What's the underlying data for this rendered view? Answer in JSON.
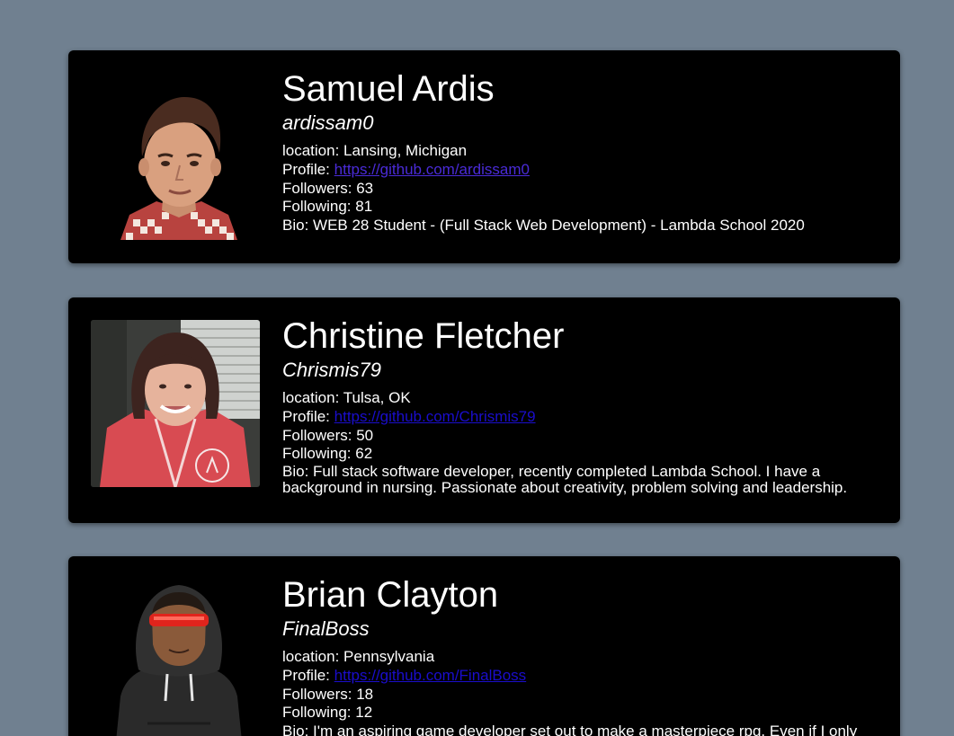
{
  "cards": [
    {
      "name": "Samuel Ardis",
      "login": "ardissam0",
      "location_label": "location: ",
      "location": "Lansing, Michigan",
      "profile_label": "Profile: ",
      "profile_url": "https://github.com/ardissam0",
      "followers_label": "Followers: ",
      "followers": "63",
      "following_label": "Following: ",
      "following": "81",
      "bio_label": "Bio: ",
      "bio": "WEB 28 Student - (Full Stack Web Development) - Lambda School 2020",
      "link_color": "#4a2bd8"
    },
    {
      "name": "Christine Fletcher",
      "login": "Chrismis79",
      "location_label": "location: ",
      "location": "Tulsa, OK",
      "profile_label": "Profile: ",
      "profile_url": "https://github.com/Chrismis79",
      "followers_label": "Followers: ",
      "followers": "50",
      "following_label": "Following: ",
      "following": "62",
      "bio_label": "Bio: ",
      "bio": "Full stack software developer, recently completed Lambda School. I have a background in nursing. Passionate about creativity, problem solving and leadership.",
      "link_color": "#1a0dcc"
    },
    {
      "name": "Brian Clayton",
      "login": "FinalBoss",
      "location_label": "location: ",
      "location": "Pennsylvania",
      "profile_label": "Profile: ",
      "profile_url": "https://github.com/FinalBoss",
      "followers_label": "Followers: ",
      "followers": "18",
      "following_label": "Following: ",
      "following": "12",
      "bio_label": "Bio: ",
      "bio": "I'm an aspiring game developer set out to make a masterpiece rpg. Even if I only",
      "link_color": "#1a0dcc"
    }
  ],
  "colors": {
    "page_background": "#708090",
    "card_background": "#000000",
    "text": "#ffffff"
  }
}
